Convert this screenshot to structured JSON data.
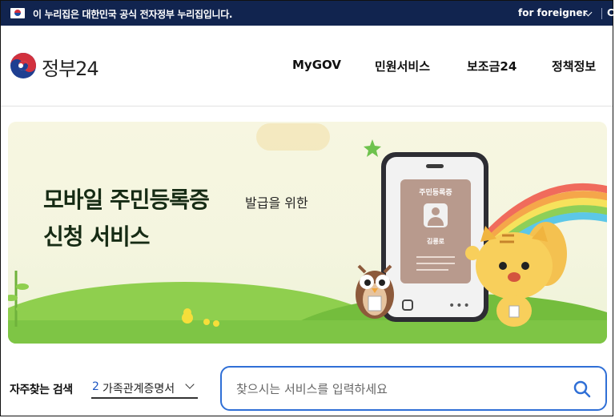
{
  "gov_bar": {
    "notice": "이 누리집은 대한민국 공식 전자정부 누리집입니다.",
    "language_link": "for foreigner",
    "next_item": "C"
  },
  "header": {
    "logo_text": "정부24",
    "nav": [
      "MyGOV",
      "민원서비스",
      "보조금24",
      "정책정보"
    ]
  },
  "banner": {
    "title_line1": "모바일 주민등록증",
    "subtitle": "발급을 위한",
    "title_line2": "신청 서비스",
    "card_title": "주민등록증",
    "card_name": "김릉로"
  },
  "search": {
    "frequent_label": "자주찾는 검색",
    "frequent_rank": "2",
    "frequent_value": "가족관계증명서",
    "placeholder": "찾으시는 서비스를 입력하세요"
  },
  "colors": {
    "gov_bar_bg": "#11244f",
    "accent_blue": "#2f6fd6",
    "banner_bg": "#f4f5df",
    "grass": "#7ec545"
  }
}
